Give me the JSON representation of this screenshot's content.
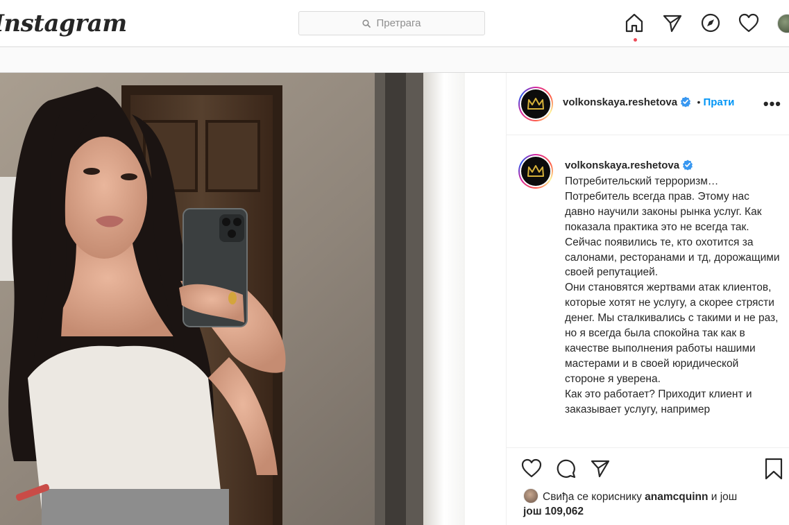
{
  "topbar": {
    "logo": "Instagram",
    "search_placeholder": "Претрага",
    "icons": [
      "home-icon",
      "direct-icon",
      "explore-icon",
      "activity-heart-icon",
      "profile-avatar"
    ]
  },
  "post": {
    "author": "volkonskaya.reshetova",
    "verified": true,
    "separator": "•",
    "follow_label": "Прати",
    "more_label": "•••",
    "caption": "Потребительский терроризм…\nПотребитель всегда прав. Этому нас давно научили законы рынка услуг. Как показала практика это не всегда так.\nСейчас появились те, кто охотится за салонами, ресторанами и тд, дорожащими своей репутацией.\nОни становятся жертвами атак клиентов, которые хотят не услугу, а скорее стрясти денег. Мы сталкивались с такими и не раз, но я всегда была спокойна так как в качестве выполнения работы нашими мастерами и в своей юридической стороне я уверена.\nКак это работает? Приходит клиент и заказывает услугу, например",
    "likes_prefix": "Свиђа се кориснику",
    "likes_user": "anamcquinn",
    "likes_mid": "и још",
    "likes_count": "још 109,062"
  },
  "colors": {
    "accent": "#0095f6",
    "verified": "#3897f0",
    "notification_dot": "#ed4956",
    "border": "#dbdbdb"
  }
}
